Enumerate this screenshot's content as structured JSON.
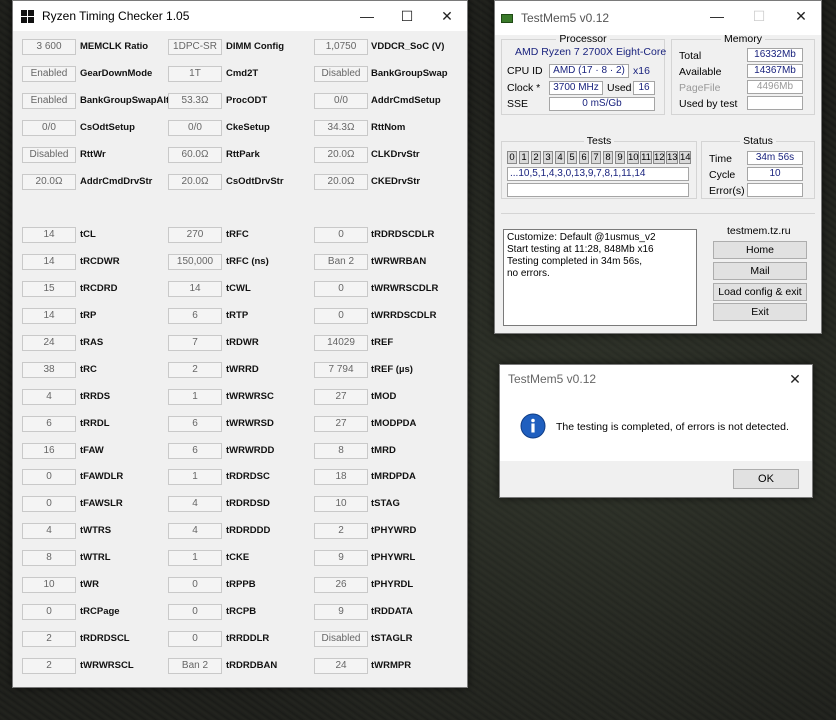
{
  "rtc": {
    "title": "Ryzen Timing Checker 1.05",
    "controls": {
      "minimize": "—",
      "maximize": "☐",
      "close": "✕"
    },
    "rows": [
      [
        [
          "3 600",
          "MEMCLK Ratio"
        ],
        [
          "1DPC-SR",
          "DIMM Config"
        ],
        [
          "1,0750",
          "VDDCR_SoC (V)"
        ]
      ],
      [
        [
          "Enabled",
          "GearDownMode"
        ],
        [
          "1T",
          "Cmd2T"
        ],
        [
          "Disabled",
          "BankGroupSwap"
        ]
      ],
      [
        [
          "Enabled",
          "BankGroupSwapAlt"
        ],
        [
          "53.3Ω",
          "ProcODT"
        ],
        [
          "0/0",
          "AddrCmdSetup"
        ]
      ],
      [
        [
          "0/0",
          "CsOdtSetup"
        ],
        [
          "0/0",
          "CkeSetup"
        ],
        [
          "34.3Ω",
          "RttNom"
        ]
      ],
      [
        [
          "Disabled",
          "RttWr"
        ],
        [
          "60.0Ω",
          "RttPark"
        ],
        [
          "20.0Ω",
          "CLKDrvStr"
        ]
      ],
      [
        [
          "20.0Ω",
          "AddrCmdDrvStr"
        ],
        [
          "20.0Ω",
          "CsOdtDrvStr"
        ],
        [
          "20.0Ω",
          "CKEDrvStr"
        ]
      ],
      null,
      [
        [
          "14",
          "tCL"
        ],
        [
          "270",
          "tRFC"
        ],
        [
          "0",
          "tRDRDSCDLR"
        ]
      ],
      [
        [
          "14",
          "tRCDWR"
        ],
        [
          "150,000",
          "tRFC (ns)"
        ],
        [
          "Ban 2",
          "tWRWRBAN"
        ]
      ],
      [
        [
          "15",
          "tRCDRD"
        ],
        [
          "14",
          "tCWL"
        ],
        [
          "0",
          "tWRWRSCDLR"
        ]
      ],
      [
        [
          "14",
          "tRP"
        ],
        [
          "6",
          "tRTP"
        ],
        [
          "0",
          "tWRRDSCDLR"
        ]
      ],
      [
        [
          "24",
          "tRAS"
        ],
        [
          "7",
          "tRDWR"
        ],
        [
          "14029",
          "tREF"
        ]
      ],
      [
        [
          "38",
          "tRC"
        ],
        [
          "2",
          "tWRRD"
        ],
        [
          "7 794",
          "tREF (µs)"
        ]
      ],
      [
        [
          "4",
          "tRRDS"
        ],
        [
          "1",
          "tWRWRSC"
        ],
        [
          "27",
          "tMOD"
        ]
      ],
      [
        [
          "6",
          "tRRDL"
        ],
        [
          "6",
          "tWRWRSD"
        ],
        [
          "27",
          "tMODPDA"
        ]
      ],
      [
        [
          "16",
          "tFAW"
        ],
        [
          "6",
          "tWRWRDD"
        ],
        [
          "8",
          "tMRD"
        ]
      ],
      [
        [
          "0",
          "tFAWDLR"
        ],
        [
          "1",
          "tRDRDSC"
        ],
        [
          "18",
          "tMRDPDA"
        ]
      ],
      [
        [
          "0",
          "tFAWSLR"
        ],
        [
          "4",
          "tRDRDSD"
        ],
        [
          "10",
          "tSTAG"
        ]
      ],
      [
        [
          "4",
          "tWTRS"
        ],
        [
          "4",
          "tRDRDDD"
        ],
        [
          "2",
          "tPHYWRD"
        ]
      ],
      [
        [
          "8",
          "tWTRL"
        ],
        [
          "1",
          "tCKE"
        ],
        [
          "9",
          "tPHYWRL"
        ]
      ],
      [
        [
          "10",
          "tWR"
        ],
        [
          "0",
          "tRPPB"
        ],
        [
          "26",
          "tPHYRDL"
        ]
      ],
      [
        [
          "0",
          "tRCPage"
        ],
        [
          "0",
          "tRCPB"
        ],
        [
          "9",
          "tRDDATA"
        ]
      ],
      [
        [
          "2",
          "tRDRDSCL"
        ],
        [
          "0",
          "tRRDDLR"
        ],
        [
          "Disabled",
          "tSTAGLR"
        ]
      ],
      [
        [
          "2",
          "tWRWRSCL"
        ],
        [
          "Ban 2",
          "tRDRDBAN"
        ],
        [
          "24",
          "tWRMPR"
        ]
      ]
    ]
  },
  "tm5": {
    "title": "TestMem5 v0.12",
    "controls": {
      "minimize": "—",
      "maximize": "☐",
      "close": "✕"
    },
    "processor": {
      "legend": "Processor",
      "name": "AMD Ryzen 7 2700X Eight-Core",
      "cpu_id_label": "CPU ID",
      "cpu_id": "AMD  (17 · 8 · 2)",
      "threads": "x16",
      "clock_label": "Clock *",
      "clock": "3700 MHz",
      "used_label": "Used",
      "used": "16",
      "sse_label": "SSE",
      "sse": "0 mS/Gb"
    },
    "memory": {
      "legend": "Memory",
      "total_label": "Total",
      "total": "16332Mb",
      "available_label": "Available",
      "available": "14367Mb",
      "pagefile_label": "PageFile",
      "pagefile": "4496Mb",
      "usedbytest_label": "Used by test",
      "usedbytest": ""
    },
    "tests": {
      "legend": "Tests",
      "cells": [
        "0",
        "1",
        "2",
        "3",
        "4",
        "5",
        "6",
        "7",
        "8",
        "9",
        "10",
        "11",
        "12",
        "13",
        "14"
      ],
      "sequence": "...10,5,1,4,3,0,13,9,7,8,1,11,14"
    },
    "status": {
      "legend": "Status",
      "time_label": "Time",
      "time": "34m 56s",
      "cycle_label": "Cycle",
      "cycle": "10",
      "errors_label": "Error(s)",
      "errors": ""
    },
    "log": [
      "Customize: Default @1usmus_v2",
      "Start testing at 11:28, 848Mb x16",
      "Testing completed in 34m 56s,",
      "no errors."
    ],
    "site": "testmem.tz.ru",
    "buttons": {
      "home": "Home",
      "mail": "Mail",
      "load": "Load config & exit",
      "exit": "Exit"
    },
    "colors": {
      "value_text": "#1a237e"
    }
  },
  "dialog": {
    "title": "TestMem5 v0.12",
    "close": "✕",
    "message": "The testing is completed, of errors is not detected.",
    "ok": "OK",
    "icon": "info-icon"
  }
}
